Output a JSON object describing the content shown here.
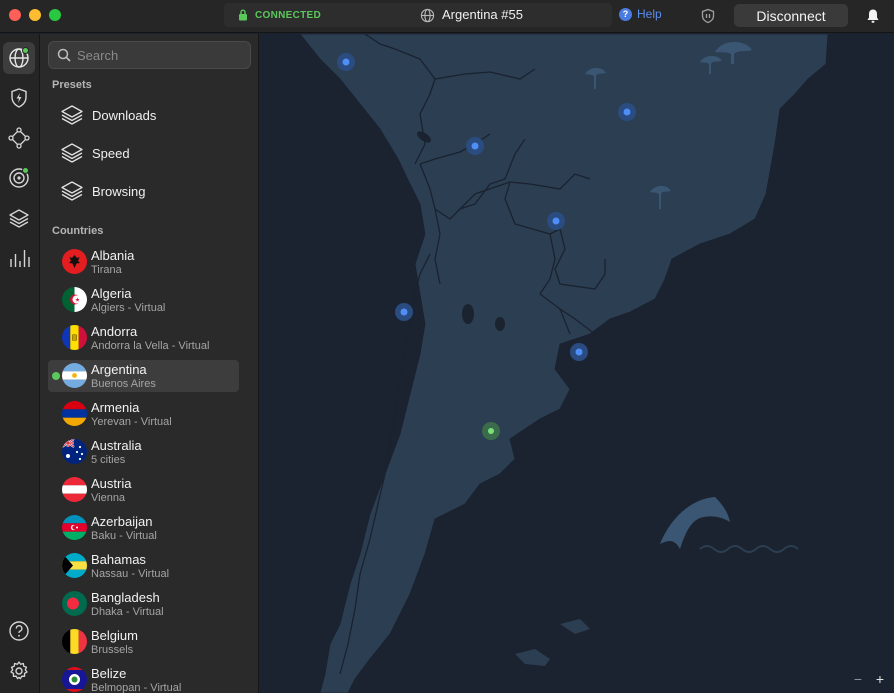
{
  "status": {
    "connection": "CONNECTED",
    "server": "Argentina #55"
  },
  "header": {
    "help_label": "Help",
    "disconnect_label": "Disconnect"
  },
  "search": {
    "placeholder": "Search"
  },
  "presets": {
    "heading": "Presets",
    "items": [
      {
        "label": "Downloads",
        "icon": "layers-icon"
      },
      {
        "label": "Speed",
        "icon": "layers-icon"
      },
      {
        "label": "Browsing",
        "icon": "layers-icon"
      }
    ]
  },
  "countries": {
    "heading": "Countries",
    "items": [
      {
        "name": "Albania",
        "sub": "Tirana"
      },
      {
        "name": "Algeria",
        "sub": "Algiers - Virtual"
      },
      {
        "name": "Andorra",
        "sub": "Andorra la Vella - Virtual"
      },
      {
        "name": "Argentina",
        "sub": "Buenos Aires"
      },
      {
        "name": "Armenia",
        "sub": "Yerevan - Virtual"
      },
      {
        "name": "Australia",
        "sub": "5 cities"
      },
      {
        "name": "Austria",
        "sub": "Vienna"
      },
      {
        "name": "Azerbaijan",
        "sub": "Baku - Virtual"
      },
      {
        "name": "Bahamas",
        "sub": "Nassau - Virtual"
      },
      {
        "name": "Bangladesh",
        "sub": "Dhaka - Virtual"
      },
      {
        "name": "Belgium",
        "sub": "Brussels"
      },
      {
        "name": "Belize",
        "sub": "Belmopan - Virtual"
      }
    ]
  },
  "map": {
    "zoom_out": "−",
    "zoom_in": "+"
  },
  "colors": {
    "accent_green": "#5ac85a",
    "link_blue": "#5b8def",
    "map_bg": "#1b2330",
    "land": "#2c3e52"
  }
}
